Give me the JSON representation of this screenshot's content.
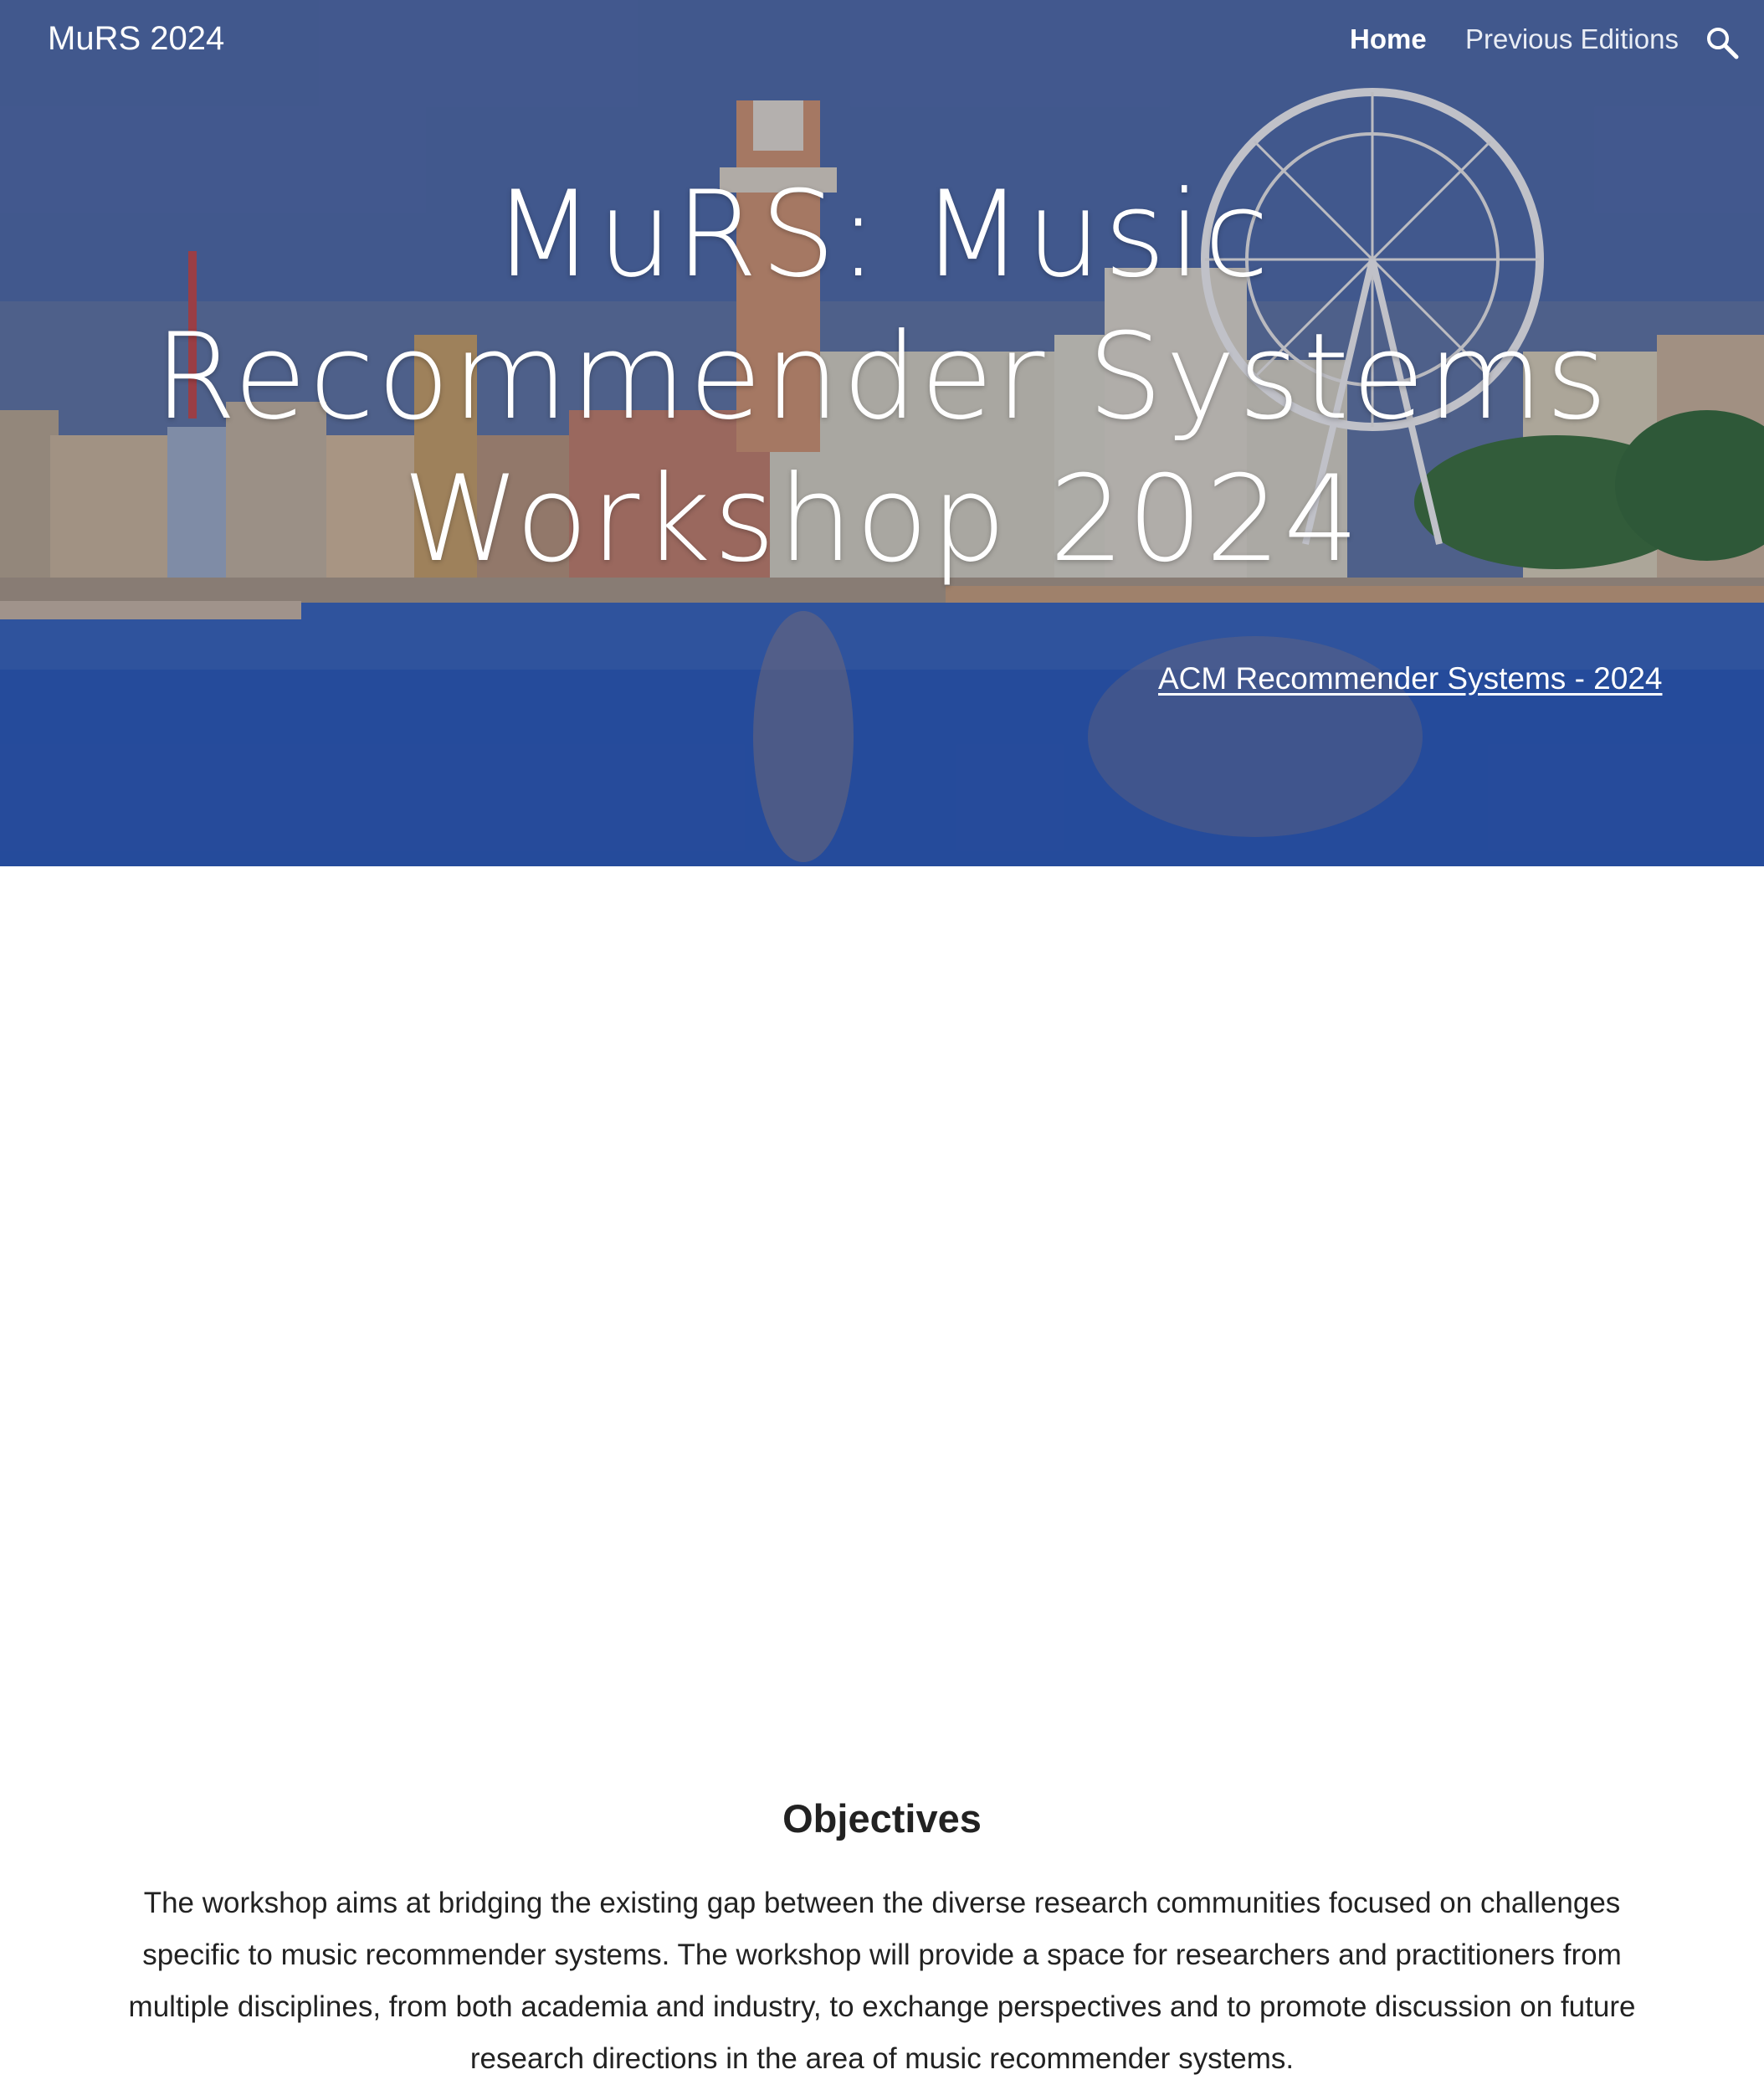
{
  "site": {
    "brand": "MuRS 2024"
  },
  "nav": {
    "items": [
      {
        "label": "Home",
        "active": true
      },
      {
        "label": "Previous Editions",
        "active": false
      }
    ],
    "search_icon": "search-icon"
  },
  "hero": {
    "title_lines": [
      "MuRS: Music",
      "Recommender Systems",
      "Workshop 2024"
    ],
    "link_text": "ACM Recommender Systems - 2024"
  },
  "objectives": {
    "heading": "Objectives",
    "body": "The workshop aims at bridging the existing gap between the diverse research communities focused on challenges specific to music recommender systems. The workshop will provide a space for researchers and practitioners from multiple disciplines, from both academia and industry, to exchange perspectives and to promote discussion on future research directions in the area of music recommender systems."
  },
  "colors": {
    "overlay": "#24408f",
    "text": "#222222",
    "hero_text": "#ffffff"
  }
}
